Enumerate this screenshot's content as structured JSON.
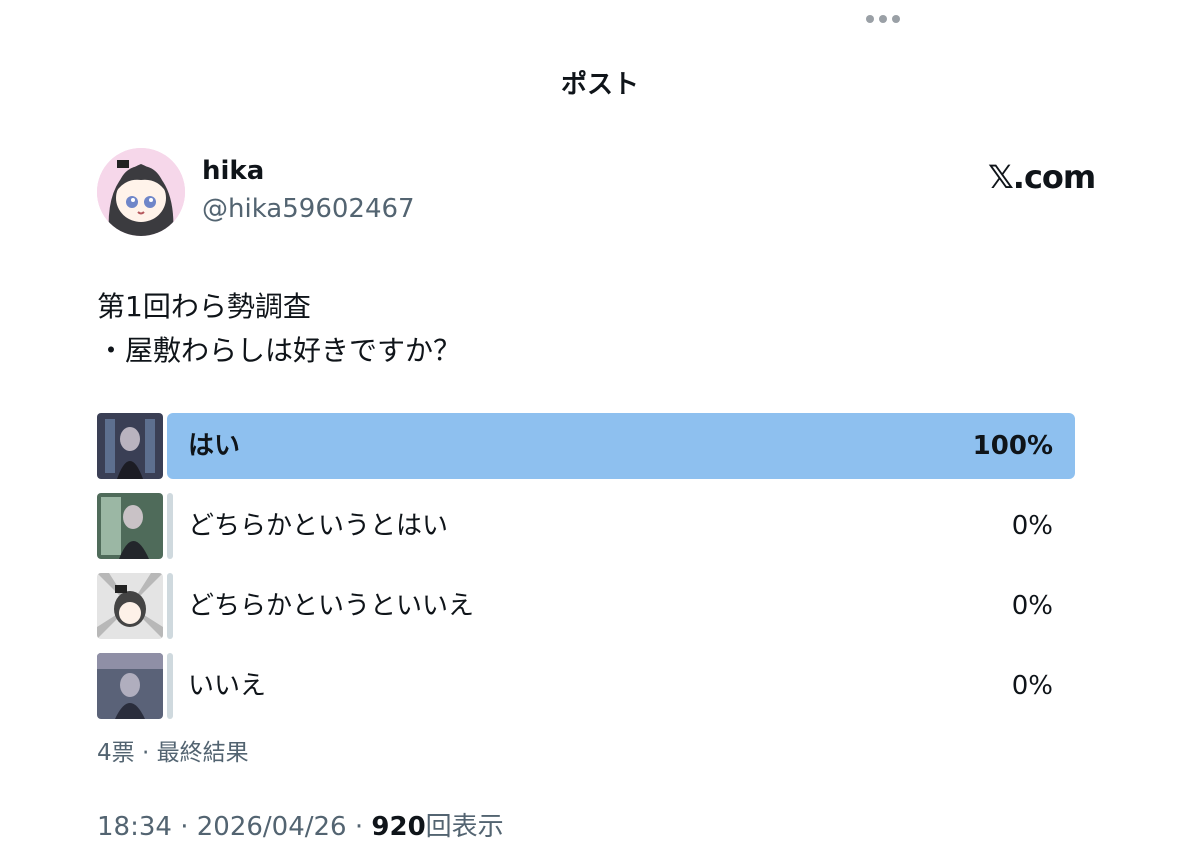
{
  "header": {
    "title": "ポスト"
  },
  "author": {
    "name": "hika",
    "handle": "@hika59602467"
  },
  "brand": "𝕏.com",
  "post": {
    "lines": [
      "第1回わら勢調査",
      "・屋敷わらしは好きですか？"
    ]
  },
  "poll": {
    "options": [
      {
        "label": "はい",
        "percent": "100%",
        "fraction": 1.0
      },
      {
        "label": "どちらかというとはい",
        "percent": "0%",
        "fraction": 0
      },
      {
        "label": "どちらかというといいえ",
        "percent": "0%",
        "fraction": 0
      },
      {
        "label": "いいえ",
        "percent": "0%",
        "fraction": 0
      }
    ],
    "votes": "4票",
    "status": "最終結果"
  },
  "meta": {
    "time": "18:34",
    "date": "2026/04/26",
    "views": "920",
    "views_suffix": "回表示"
  },
  "colors": {
    "winner_bar": "#8ec0ef",
    "empty_bar": "#cfd9de",
    "secondary_text": "#536471"
  }
}
